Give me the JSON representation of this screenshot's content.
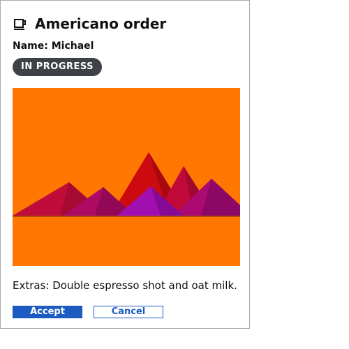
{
  "card": {
    "icon": "coffee-cup-icon",
    "title": "Americano order",
    "name_line": "Name: Michael",
    "status_badge": "IN PROGRESS",
    "image": {
      "icon": "mountains-illustration",
      "background_color": "#ff7700"
    },
    "extras": "Extras: Double espresso shot and oat milk.",
    "accept_label": "Accept",
    "cancel_label": "Cancel"
  },
  "colors": {
    "accent": "#1c5bc1",
    "badge_background": "#3e4246",
    "border": "#a9a9a9"
  }
}
